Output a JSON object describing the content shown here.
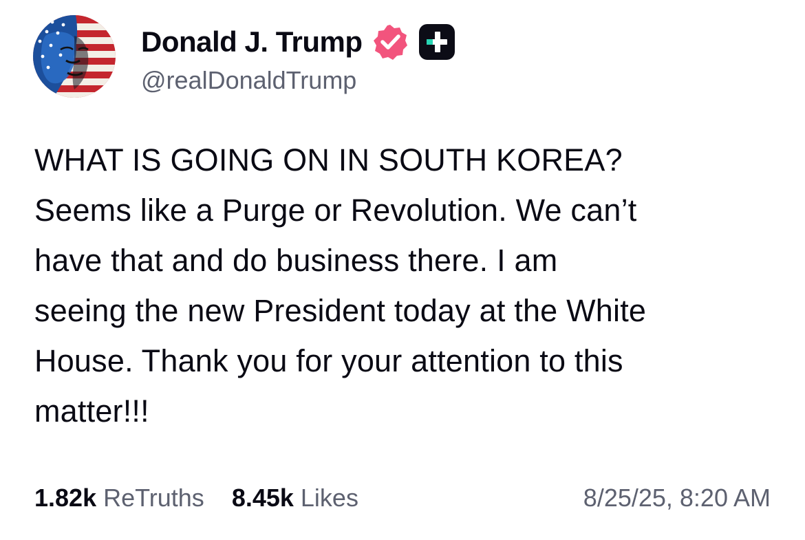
{
  "author": {
    "display_name": "Donald J. Trump",
    "handle": "@realDonaldTrump",
    "avatar_icon": "flag-portrait-avatar",
    "verified_icon": "verified-badge-icon",
    "plus_icon": "plus-badge-icon"
  },
  "post": {
    "text": "WHAT IS GOING ON IN SOUTH KOREA?\nSeems like a Purge or Revolution. We can’t\nhave that and do business there. I am\nseeing the new President today at the White\nHouse. Thank you for your attention to this\nmatter!!!"
  },
  "stats": {
    "retruths_count": "1.82k",
    "retruths_label": "ReTruths",
    "likes_count": "8.45k",
    "likes_label": "Likes"
  },
  "timestamp": "8/25/25, 8:20 AM",
  "colors": {
    "text_primary": "#0a0a14",
    "text_secondary": "#5d6170",
    "verified_pink": "#f2547d",
    "plus_badge_bg": "#0c0c16",
    "plus_badge_accent": "#27d5b3"
  }
}
